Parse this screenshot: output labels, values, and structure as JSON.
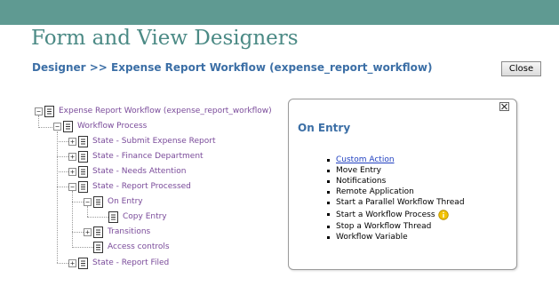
{
  "header": {
    "title": "Form and View Designers",
    "breadcrumb": "Designer >> Expense Report Workflow (expense_report_workflow)",
    "close_label": "Close"
  },
  "tree": {
    "root": "Expense Report Workflow (expense_report_workflow)",
    "process": "Workflow Process",
    "states": [
      "State - Submit Expense Report",
      "State - Finance Department",
      "State - Needs Attention",
      "State - Report Processed"
    ],
    "on_entry": "On Entry",
    "copy_entry": "Copy Entry",
    "transitions": "Transitions",
    "access_controls": "Access controls",
    "last_state": "State - Report Filed",
    "expanded_symbol": "−",
    "collapsed_symbol": "+"
  },
  "panel": {
    "title": "On Entry",
    "actions": [
      "Custom Action",
      "Move Entry",
      "Notifications",
      "Remote Application",
      "Start a Parallel Workflow Thread",
      "Start a Workflow Process",
      "Stop a Workflow Thread",
      "Workflow Variable"
    ]
  },
  "colors": {
    "top_band": "#5f9a92",
    "title": "#4b8a85",
    "breadcrumb": "#3c6fa6",
    "tree_link": "#7a4b9a",
    "action_link": "#2040c0",
    "info_icon": "#f2c200"
  },
  "icons": {
    "tree_node": "document-icon",
    "panel_close": "close-icon",
    "info": "info-icon"
  }
}
